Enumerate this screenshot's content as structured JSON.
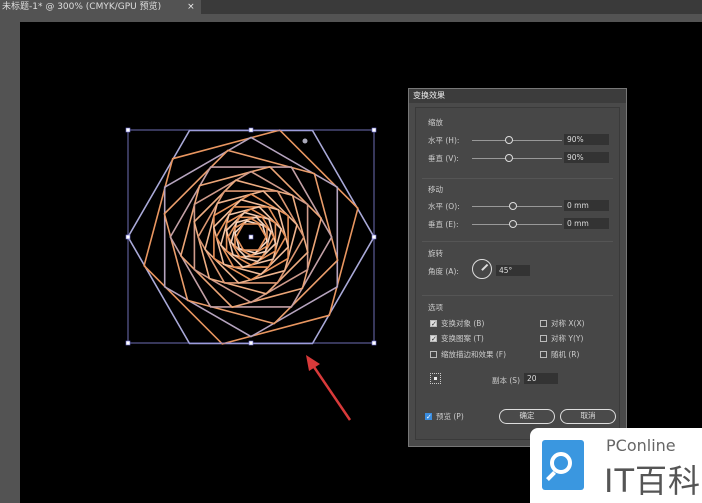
{
  "document_tab": {
    "title": "未标题-1* @ 300% (CMYK/GPU 预览)",
    "close": "×"
  },
  "dialog": {
    "title": "变换效果",
    "scale": {
      "label": "缩放",
      "horizontal_label": "水平 (H):",
      "horizontal_value": "90%",
      "horizontal_slider": 90,
      "vertical_label": "垂直 (V):",
      "vertical_value": "90%",
      "vertical_slider": 90
    },
    "move": {
      "label": "移动",
      "horizontal_label": "水平 (O):",
      "horizontal_value": "0 mm",
      "vertical_label": "垂直 (E):",
      "vertical_value": "0 mm"
    },
    "rotate": {
      "label": "旋转",
      "angle_label": "角度 (A):",
      "angle_value": "45°",
      "angle": 45
    },
    "options": {
      "label": "选项",
      "transform_objects": "变换对象 (B)",
      "transform_patterns": "变换图案 (T)",
      "scale_strokes": "缩放描边和效果 (F)",
      "reflect_x": "对称 X(X)",
      "reflect_y": "对称 Y(Y)",
      "random": "随机 (R)"
    },
    "copies_label": "副本 (S)",
    "copies_value": "20",
    "preview_label": "预览 (P)",
    "ok_label": "确定",
    "cancel_label": "取消"
  },
  "watermark": {
    "brand": "PConline",
    "name": "IT百科"
  },
  "colors": {
    "highlight_ellipse": "#d83a3a",
    "arrow": "#d83a3a",
    "outer_stroke": "#a9a9d8",
    "inner_stroke": "#e8925a"
  }
}
